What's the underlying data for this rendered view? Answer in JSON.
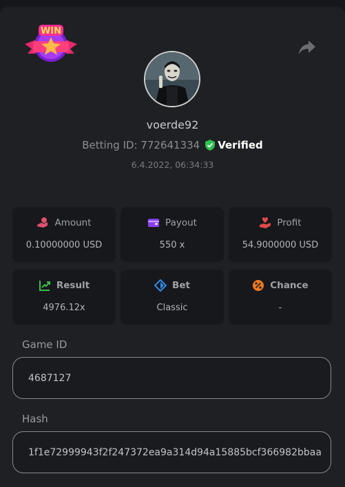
{
  "badge": {
    "text": "WIN"
  },
  "user": {
    "name": "voerde92",
    "betting_id_label": "Betting ID: 772641334",
    "verified_label": "Verified",
    "date": "6.4.2022, 06:34:33"
  },
  "stats": [
    {
      "label": "Amount",
      "value": "0.10000000 USD",
      "icon": "hand-coin-icon",
      "color": "#e0516f"
    },
    {
      "label": "Payout",
      "value": "550 x",
      "icon": "wallet-icon",
      "color": "#8a3ff0"
    },
    {
      "label": "Profit",
      "value": "54.9000000 USD",
      "icon": "hand-heart-icon",
      "color": "#e04a4a"
    },
    {
      "label": "Result",
      "value": "4976.12x",
      "icon": "chart-up-icon",
      "color": "#39c04a"
    },
    {
      "label": "Bet",
      "value": "Classic",
      "icon": "tag-icon",
      "color": "#2f8ce8"
    },
    {
      "label": "Chance",
      "value": "-",
      "icon": "percent-icon",
      "color": "#f07a22"
    }
  ],
  "game_id": {
    "label": "Game ID",
    "value": "4687127"
  },
  "hash": {
    "label": "Hash",
    "value": "1f1e72999943f2f247372ea9a314d94a15885bcf366982bbaa"
  }
}
